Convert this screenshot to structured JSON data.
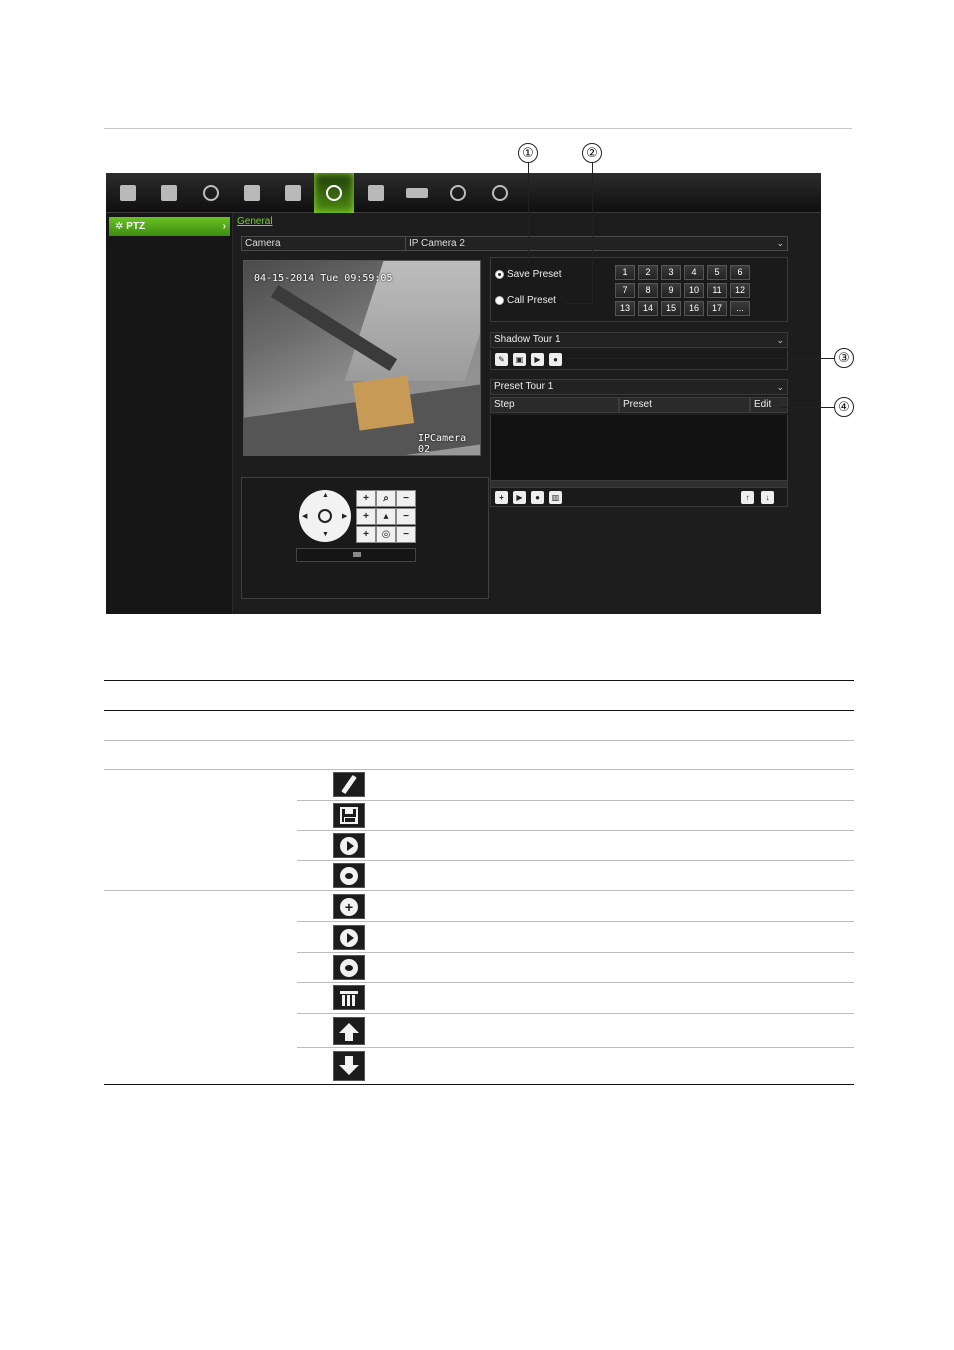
{
  "callouts": [
    "①",
    "②",
    "③",
    "④"
  ],
  "toolbar": {
    "icons": [
      "monitor-icon",
      "camera-icon",
      "gauge-icon",
      "network-icon",
      "bell-icon",
      "ptz-icon",
      "user-icon",
      "hdd-icon",
      "help-icon",
      "power-icon"
    ],
    "active_index": 5
  },
  "sidebar": {
    "items": [
      {
        "label": "PTZ",
        "chevron": "›"
      }
    ]
  },
  "tabs": [
    {
      "label": "General"
    }
  ],
  "camera": {
    "label": "Camera",
    "value": "IP Camera 2",
    "arrow": "⌄"
  },
  "video": {
    "timestamp": "04-15-2014 Tue 09:59:05",
    "camera_name": "IPCamera 02"
  },
  "preset": {
    "save_label": "Save Preset",
    "call_label": "Call Preset",
    "numbers": [
      "1",
      "2",
      "3",
      "4",
      "5",
      "6",
      "7",
      "8",
      "9",
      "10",
      "11",
      "12",
      "13",
      "14",
      "15",
      "16",
      "17",
      "..."
    ]
  },
  "shadow_tour": {
    "value": "Shadow Tour 1",
    "arrow": "⌄"
  },
  "preset_tour": {
    "value": "Preset Tour 1",
    "arrow": "⌄",
    "columns": [
      "Step",
      "Preset",
      "Edit"
    ]
  },
  "ptz_controls": {
    "zoom": [
      "+",
      "−"
    ],
    "focus": [
      "+",
      "−"
    ],
    "iris": [
      "+",
      "−"
    ]
  },
  "colors": {
    "accent": "#6ac322",
    "panel": "#1d1d1d"
  }
}
